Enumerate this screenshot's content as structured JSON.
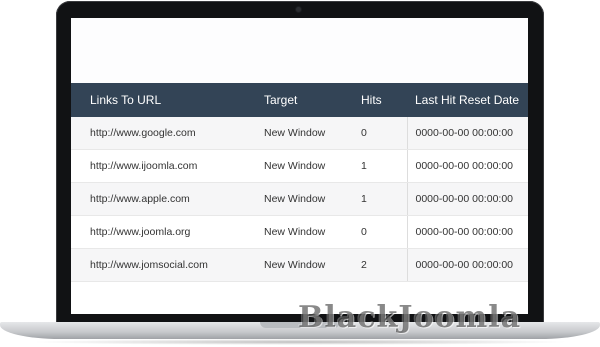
{
  "table": {
    "headers": [
      "Links To URL",
      "Target",
      "Hits",
      "Last Hit Reset Date"
    ],
    "rows": [
      {
        "url": "http://www.google.com",
        "target": "New Window",
        "hits": "0",
        "reset": "0000-00-00 00:00:00"
      },
      {
        "url": "http://www.ijoomla.com",
        "target": "New Window",
        "hits": "1",
        "reset": "0000-00-00 00:00:00"
      },
      {
        "url": "http://www.apple.com",
        "target": "New Window",
        "hits": "1",
        "reset": "0000-00-00 00:00:00"
      },
      {
        "url": "http://www.joomla.org",
        "target": "New Window",
        "hits": "0",
        "reset": "0000-00-00 00:00:00"
      },
      {
        "url": "http://www.jomsocial.com",
        "target": "New Window",
        "hits": "2",
        "reset": "0000-00-00 00:00:00"
      }
    ]
  },
  "watermark": {
    "text": "BlackJoomla"
  },
  "colors": {
    "header_bg": "#334456",
    "header_text": "#ffffff",
    "row_alt": "#f6f6f7"
  }
}
